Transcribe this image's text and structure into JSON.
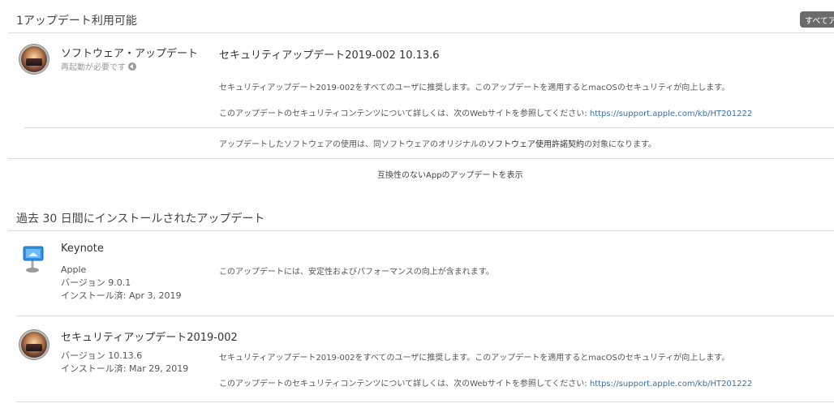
{
  "available": {
    "title": "1アップデート利用可能",
    "all_button": "すべてア",
    "item": {
      "app_name": "ソフトウェア・アップデート",
      "restart_note": "再起動が必要です",
      "update_title": "セキュリティアップデート2019-002 10.13.6",
      "desc1": "セキュリティアップデート2019-002をすべてのユーザに推奨します。このアップデートを適用するとmacOSのセキュリティが向上します。",
      "desc2_prefix": "このアップデートのセキュリティコンテンツについて詳しくは、次のWebサイトを参照してください: ",
      "desc2_link": "https://support.apple.com/kb/HT201222",
      "license_prefix": "アップデートしたソフトウェアの使用は、同ソフトウェアのオリジナルの",
      "license_link": "ソフトウェア使用許諾契約",
      "license_suffix": "の対象になります。"
    },
    "show_incompatible": "互換性のないAppのアップデートを表示"
  },
  "installed": {
    "title": "過去 30 日間にインストールされたアップデート",
    "items": [
      {
        "name": "Keynote",
        "vendor": "Apple",
        "version": "バージョン 9.0.1",
        "installed": "インストール済: Apr 3, 2019",
        "desc": "このアップデートには、安定性およびパフォーマンスの向上が含まれます。"
      },
      {
        "name": "セキュリティアップデート2019-002",
        "version": "バージョン 10.13.6",
        "installed": "インストール済: Mar 29, 2019",
        "desc1": "セキュリティアップデート2019-002をすべてのユーザに推奨します。このアップデートを適用するとmacOSのセキュリティが向上します。",
        "desc2_prefix": "このアップデートのセキュリティコンテンツについて詳しくは、次のWebサイトを参照してください: ",
        "desc2_link": "https://support.apple.com/kb/HT201222"
      }
    ]
  },
  "icons": {
    "macos": "macos-high-sierra-icon",
    "keynote": "keynote-icon",
    "restart": "restart-required-icon"
  }
}
